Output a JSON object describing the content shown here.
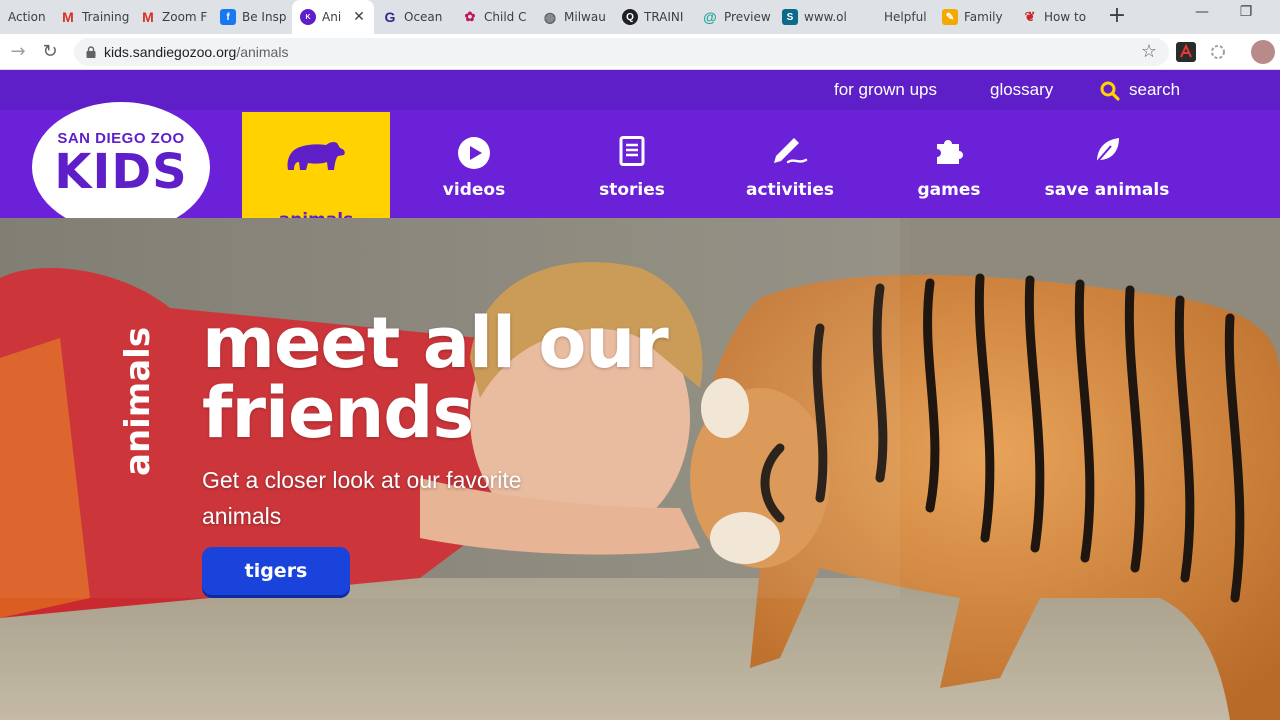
{
  "browser": {
    "tabs": [
      {
        "title": "Action",
        "favicon": "doc-icon",
        "color": "#5f6368"
      },
      {
        "title": "Training",
        "favicon": "gmail-icon",
        "color": "#d93025"
      },
      {
        "title": "Zoom F",
        "favicon": "gmail-icon",
        "color": "#d93025"
      },
      {
        "title": "Be Insp",
        "favicon": "facebook-icon",
        "color": "#1877f2"
      },
      {
        "title": "Ani",
        "favicon": "sdzkids-icon",
        "color": "#5e1fc9"
      },
      {
        "title": "Ocean",
        "favicon": "g-icon",
        "color": "#2f2b8c"
      },
      {
        "title": "Child C",
        "favicon": "flower-icon",
        "color": "#c2185b"
      },
      {
        "title": "Milwau",
        "favicon": "globe-icon",
        "color": "#5f6368"
      },
      {
        "title": "TRAINI",
        "favicon": "q-icon",
        "color": "#202124"
      },
      {
        "title": "Preview",
        "favicon": "swirl-icon",
        "color": "#27a79a"
      },
      {
        "title": "www.ol",
        "favicon": "sharepoint-icon",
        "color": "#0b6a8a"
      },
      {
        "title": "Helpful",
        "favicon": "blank-icon",
        "color": "#dee1e6"
      },
      {
        "title": "Family",
        "favicon": "pencil-icon",
        "color": "#f2a900"
      },
      {
        "title": "How to",
        "favicon": "people-icon",
        "color": "#c62828"
      }
    ],
    "url_host": "kids.sandiegozoo.org",
    "url_path": "/animals",
    "window": {
      "minimize": "—",
      "restore": "❐"
    }
  },
  "site": {
    "logo_top": "SAN DIEGO ZOO",
    "logo_main": "KIDS",
    "top_links": {
      "grownups": "for grown ups",
      "glossary": "glossary",
      "search": "search"
    },
    "nav": [
      {
        "label": "animals",
        "icon": "bear-icon",
        "active": true
      },
      {
        "label": "videos",
        "icon": "play-icon",
        "active": false
      },
      {
        "label": "stories",
        "icon": "document-icon",
        "active": false
      },
      {
        "label": "activities",
        "icon": "pencil-icon",
        "active": false
      },
      {
        "label": "games",
        "icon": "puzzle-icon",
        "active": false
      },
      {
        "label": "save animals",
        "icon": "leaf-icon",
        "active": false
      }
    ],
    "colors": {
      "brand_purple": "#6a21d8",
      "top_purple": "#5e1fc9",
      "active_yellow": "#ffd200",
      "cta_blue": "#1a43dc",
      "search_yellow": "#ffd200"
    }
  },
  "hero": {
    "section_label": "animals",
    "headline_1": "meet all our",
    "headline_2": "friends",
    "subtext": "Get a closer look at our favorite animals",
    "cta": "tigers"
  }
}
